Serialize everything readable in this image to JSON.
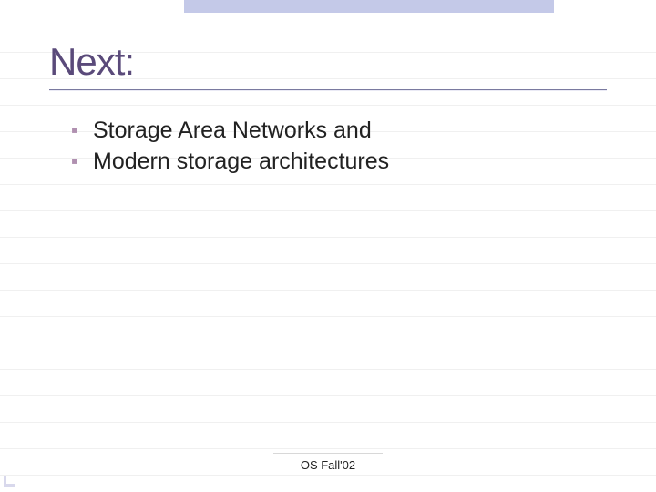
{
  "title": "Next:",
  "bullets": [
    {
      "marker": "▪",
      "text": "Storage Area Networks and"
    },
    {
      "marker": "▪",
      "text": "Modern storage architectures"
    }
  ],
  "footer": "OS Fall'02"
}
